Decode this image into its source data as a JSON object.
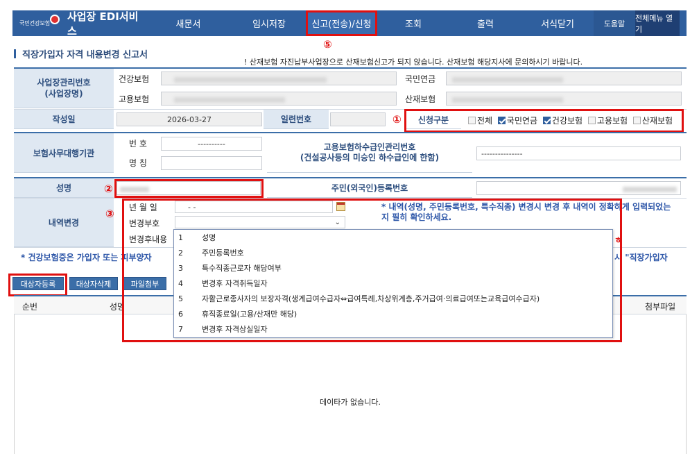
{
  "nav": {
    "logo_text": "국민건강보험",
    "app_title": "사업장 EDI서비스",
    "items": [
      "새문서",
      "임시저장",
      "신고(전송)/신청",
      "조회",
      "출력",
      "서식닫기"
    ],
    "help": "도움말",
    "all_menu": "전체메뉴 열기"
  },
  "markers": [
    "①",
    "②",
    "③",
    "⑤"
  ],
  "page_title": "직장가입자 자격 내용변경 신고서",
  "notice": "! 산재보험 자진납부사업장으로 산재보험신고가 되지 않습니다. 산재보험 해당지사에 문의하시기 바랍니다.",
  "form": {
    "biz_no_label": "사업장관리번호\n(사업장명)",
    "health_label": "건강보험",
    "employ_label": "고용보험",
    "pension_label": "국민연금",
    "industrial_label": "산재보험",
    "write_date_label": "작성일",
    "write_date": "2026-03-27",
    "serial_label": "일련번호",
    "apply_type_label": "신청구분",
    "apply_types": [
      {
        "label": "전체",
        "checked": false
      },
      {
        "label": "국민연금",
        "checked": true
      },
      {
        "label": "건강보험",
        "checked": true
      },
      {
        "label": "고용보험",
        "checked": false
      },
      {
        "label": "산재보험",
        "checked": false
      }
    ],
    "agency_label": "보험사무대행기관",
    "agency_no_label": "번 호",
    "agency_no_value": "----------",
    "agency_name_label": "명 칭",
    "subcontract_label": "고용보험하수급인관리번호\n(건설공사등의 미승인 하수급인에 한함)",
    "subcontract_value": "---------------",
    "name_label": "성명",
    "rrn_label": "주민(외국인)등록번호",
    "change_label": "내역변경",
    "ym_label": "년 월 일",
    "ym_value": "- -",
    "change_code_label": "변경부호",
    "after_label": "변경후내용",
    "change_note": "* 내역(성명, 주민등록번호, 특수직종) 변경시 변경 후 내역이 정확하게 입력되었는지 필히 확인하세요.",
    "health_note": "* 건강보험증은 가입자 또는 피부양자",
    "health_note_tail": "시 \"직장가입자",
    "trailing_mark": "ㅎ"
  },
  "buttons": {
    "register": "대상자등록",
    "delete": "대상자삭제",
    "attach": "파일첨부"
  },
  "grid": {
    "col_seq": "순번",
    "col_name": "성명",
    "col_attach": "첨부파일",
    "empty_text": "데이타가 없습니다."
  },
  "dropdown_options": [
    {
      "code": "1",
      "label": "성명"
    },
    {
      "code": "2",
      "label": "주민등록번호"
    },
    {
      "code": "3",
      "label": "특수직종근로자 해당여부"
    },
    {
      "code": "4",
      "label": "변경후 자격취득일자"
    },
    {
      "code": "5",
      "label": "자활근로종사자의 보장자격(생계급여수급자⇔급여특례,차상위계층,주거급여·의료급여또는교육급여수급자)"
    },
    {
      "code": "6",
      "label": "휴직종료일(고용/산재만 해당)"
    },
    {
      "code": "7",
      "label": "변경후 자격상실일자"
    }
  ],
  "colors": {
    "nav_bg": "#2f5f9e",
    "highlight": "#e01010",
    "label_bg": "#dfe8f2"
  }
}
